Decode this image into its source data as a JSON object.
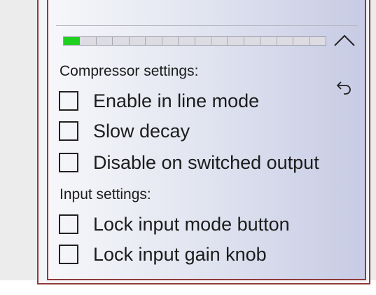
{
  "meter": {
    "segments_total": 16,
    "segments_lit": 1,
    "lit_color": "#20d020"
  },
  "icons": {
    "collapse": "chevron-up-icon",
    "undo": "undo-arrow-icon"
  },
  "compressor": {
    "heading": "Compressor settings:",
    "options": [
      {
        "label": "Enable in line mode",
        "checked": false
      },
      {
        "label": "Slow decay",
        "checked": false
      },
      {
        "label": "Disable on switched output",
        "checked": false
      }
    ]
  },
  "input": {
    "heading": "Input settings:",
    "options": [
      {
        "label": "Lock input mode button",
        "checked": false
      },
      {
        "label": "Lock input gain knob",
        "checked": false
      }
    ]
  },
  "colors": {
    "frame": "#8f3a3a",
    "panel_gradient_end": "#c7cbe4"
  }
}
